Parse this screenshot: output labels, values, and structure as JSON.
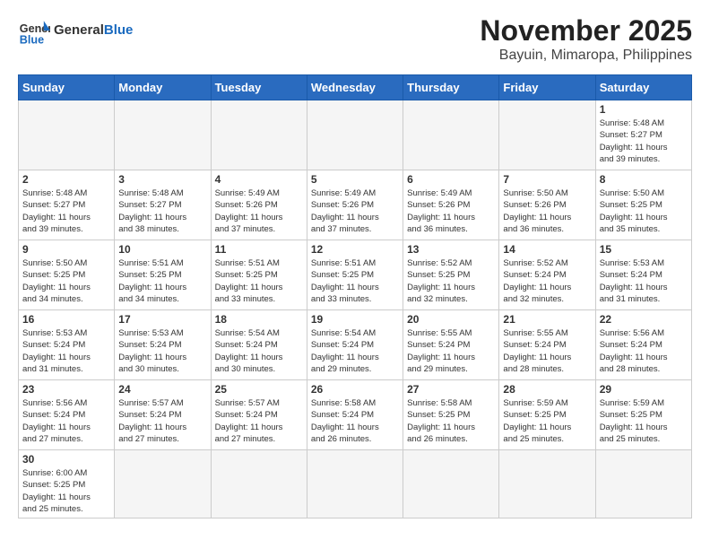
{
  "logo": {
    "text_general": "General",
    "text_blue": "Blue"
  },
  "title": "November 2025",
  "location": "Bayuin, Mimaropa, Philippines",
  "days_of_week": [
    "Sunday",
    "Monday",
    "Tuesday",
    "Wednesday",
    "Thursday",
    "Friday",
    "Saturday"
  ],
  "weeks": [
    [
      {
        "day": "",
        "info": ""
      },
      {
        "day": "",
        "info": ""
      },
      {
        "day": "",
        "info": ""
      },
      {
        "day": "",
        "info": ""
      },
      {
        "day": "",
        "info": ""
      },
      {
        "day": "",
        "info": ""
      },
      {
        "day": "1",
        "info": "Sunrise: 5:48 AM\nSunset: 5:27 PM\nDaylight: 11 hours\nand 39 minutes."
      }
    ],
    [
      {
        "day": "2",
        "info": "Sunrise: 5:48 AM\nSunset: 5:27 PM\nDaylight: 11 hours\nand 39 minutes."
      },
      {
        "day": "3",
        "info": "Sunrise: 5:48 AM\nSunset: 5:27 PM\nDaylight: 11 hours\nand 38 minutes."
      },
      {
        "day": "4",
        "info": "Sunrise: 5:49 AM\nSunset: 5:26 PM\nDaylight: 11 hours\nand 37 minutes."
      },
      {
        "day": "5",
        "info": "Sunrise: 5:49 AM\nSunset: 5:26 PM\nDaylight: 11 hours\nand 37 minutes."
      },
      {
        "day": "6",
        "info": "Sunrise: 5:49 AM\nSunset: 5:26 PM\nDaylight: 11 hours\nand 36 minutes."
      },
      {
        "day": "7",
        "info": "Sunrise: 5:50 AM\nSunset: 5:26 PM\nDaylight: 11 hours\nand 36 minutes."
      },
      {
        "day": "8",
        "info": "Sunrise: 5:50 AM\nSunset: 5:25 PM\nDaylight: 11 hours\nand 35 minutes."
      }
    ],
    [
      {
        "day": "9",
        "info": "Sunrise: 5:50 AM\nSunset: 5:25 PM\nDaylight: 11 hours\nand 34 minutes."
      },
      {
        "day": "10",
        "info": "Sunrise: 5:51 AM\nSunset: 5:25 PM\nDaylight: 11 hours\nand 34 minutes."
      },
      {
        "day": "11",
        "info": "Sunrise: 5:51 AM\nSunset: 5:25 PM\nDaylight: 11 hours\nand 33 minutes."
      },
      {
        "day": "12",
        "info": "Sunrise: 5:51 AM\nSunset: 5:25 PM\nDaylight: 11 hours\nand 33 minutes."
      },
      {
        "day": "13",
        "info": "Sunrise: 5:52 AM\nSunset: 5:25 PM\nDaylight: 11 hours\nand 32 minutes."
      },
      {
        "day": "14",
        "info": "Sunrise: 5:52 AM\nSunset: 5:24 PM\nDaylight: 11 hours\nand 32 minutes."
      },
      {
        "day": "15",
        "info": "Sunrise: 5:53 AM\nSunset: 5:24 PM\nDaylight: 11 hours\nand 31 minutes."
      }
    ],
    [
      {
        "day": "16",
        "info": "Sunrise: 5:53 AM\nSunset: 5:24 PM\nDaylight: 11 hours\nand 31 minutes."
      },
      {
        "day": "17",
        "info": "Sunrise: 5:53 AM\nSunset: 5:24 PM\nDaylight: 11 hours\nand 30 minutes."
      },
      {
        "day": "18",
        "info": "Sunrise: 5:54 AM\nSunset: 5:24 PM\nDaylight: 11 hours\nand 30 minutes."
      },
      {
        "day": "19",
        "info": "Sunrise: 5:54 AM\nSunset: 5:24 PM\nDaylight: 11 hours\nand 29 minutes."
      },
      {
        "day": "20",
        "info": "Sunrise: 5:55 AM\nSunset: 5:24 PM\nDaylight: 11 hours\nand 29 minutes."
      },
      {
        "day": "21",
        "info": "Sunrise: 5:55 AM\nSunset: 5:24 PM\nDaylight: 11 hours\nand 28 minutes."
      },
      {
        "day": "22",
        "info": "Sunrise: 5:56 AM\nSunset: 5:24 PM\nDaylight: 11 hours\nand 28 minutes."
      }
    ],
    [
      {
        "day": "23",
        "info": "Sunrise: 5:56 AM\nSunset: 5:24 PM\nDaylight: 11 hours\nand 27 minutes."
      },
      {
        "day": "24",
        "info": "Sunrise: 5:57 AM\nSunset: 5:24 PM\nDaylight: 11 hours\nand 27 minutes."
      },
      {
        "day": "25",
        "info": "Sunrise: 5:57 AM\nSunset: 5:24 PM\nDaylight: 11 hours\nand 27 minutes."
      },
      {
        "day": "26",
        "info": "Sunrise: 5:58 AM\nSunset: 5:24 PM\nDaylight: 11 hours\nand 26 minutes."
      },
      {
        "day": "27",
        "info": "Sunrise: 5:58 AM\nSunset: 5:25 PM\nDaylight: 11 hours\nand 26 minutes."
      },
      {
        "day": "28",
        "info": "Sunrise: 5:59 AM\nSunset: 5:25 PM\nDaylight: 11 hours\nand 25 minutes."
      },
      {
        "day": "29",
        "info": "Sunrise: 5:59 AM\nSunset: 5:25 PM\nDaylight: 11 hours\nand 25 minutes."
      }
    ],
    [
      {
        "day": "30",
        "info": "Sunrise: 6:00 AM\nSunset: 5:25 PM\nDaylight: 11 hours\nand 25 minutes."
      },
      {
        "day": "",
        "info": ""
      },
      {
        "day": "",
        "info": ""
      },
      {
        "day": "",
        "info": ""
      },
      {
        "day": "",
        "info": ""
      },
      {
        "day": "",
        "info": ""
      },
      {
        "day": "",
        "info": ""
      }
    ]
  ]
}
